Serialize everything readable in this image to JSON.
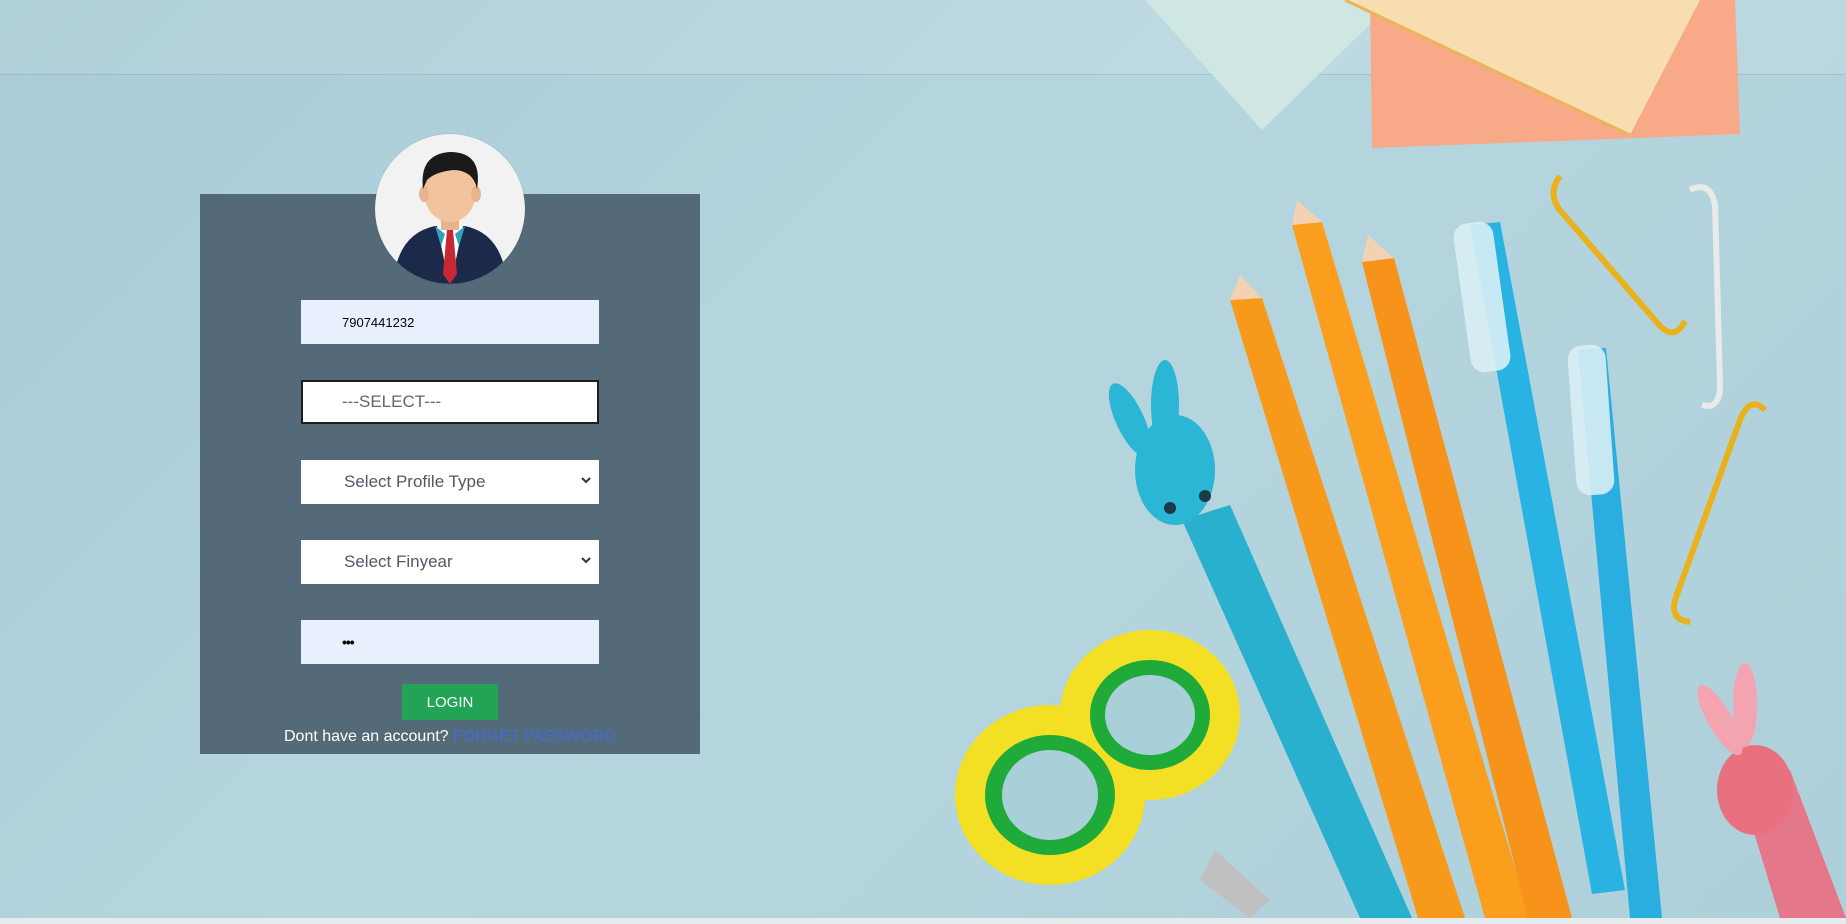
{
  "login": {
    "username_value": "7907441232",
    "org_select_value": "---SELECT---",
    "profile_type_value": "Select Profile Type",
    "finyear_value": "Select Finyear",
    "password_masked": "•••",
    "login_label": "LOGIN",
    "no_account_text": "Dont have an account?",
    "forget_password_label": "FORGET PASSWORD"
  },
  "colors": {
    "panel": "#556a78",
    "login_button": "#22a356",
    "link": "#3d6fd6",
    "background": "#b4d3dc"
  },
  "icons": {
    "avatar": "businessman-avatar-icon",
    "select_chevron": "chevron-down-icon"
  }
}
